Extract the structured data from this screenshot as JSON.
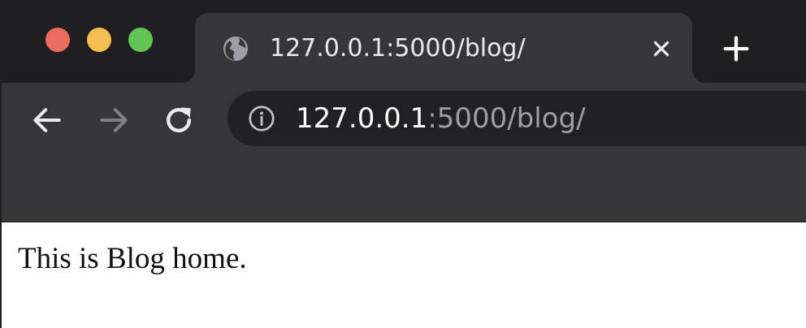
{
  "window": {
    "controls": {
      "close_color": "#ed6a5e",
      "minimize_color": "#f4bf4f",
      "zoom_color": "#61c554"
    }
  },
  "tab": {
    "title": "127.0.0.1:5000/blog/",
    "favicon": "globe-icon",
    "close_icon": "close-icon"
  },
  "toolbar": {
    "back_icon": "arrow-left-icon",
    "forward_icon": "arrow-right-icon",
    "reload_icon": "reload-icon",
    "new_tab_icon": "plus-icon"
  },
  "omnibox": {
    "info_icon": "info-icon",
    "url_host": "127.0.0.1",
    "url_rest": ":5000/blog/"
  },
  "page": {
    "text": "This is Blog home."
  }
}
